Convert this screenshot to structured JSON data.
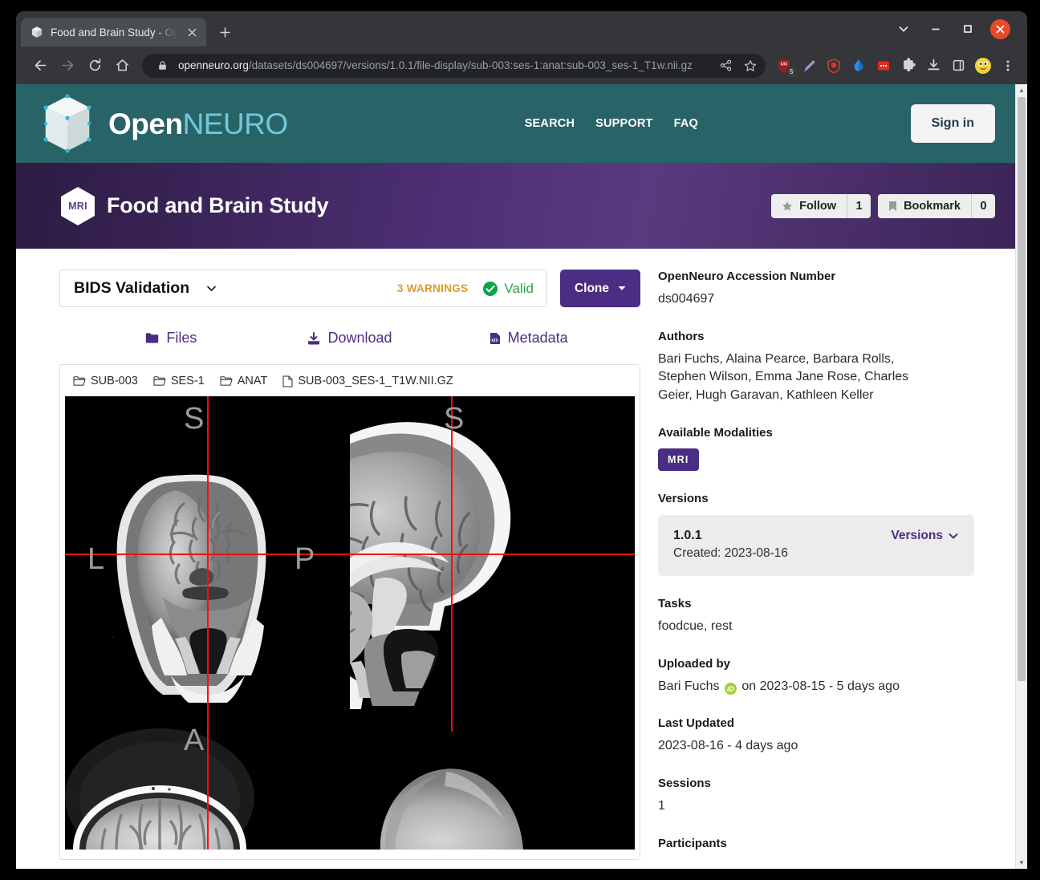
{
  "browser": {
    "tab": {
      "title": "Food and Brain Study - Op",
      "favicon_icon": "cube-icon",
      "close_icon": "close-icon"
    },
    "new_tab_icon": "plus-icon",
    "window_controls": [
      {
        "name": "chrome-menu-chevron",
        "icon": "chevron-down-icon"
      },
      {
        "name": "minimize-button",
        "icon": "minimize-icon"
      },
      {
        "name": "maximize-button",
        "icon": "maximize-icon"
      },
      {
        "name": "close-window-button",
        "icon": "close-icon"
      }
    ],
    "toolbar": {
      "back_icon": "back-arrow-icon",
      "forward_icon": "forward-arrow-icon",
      "reload_icon": "reload-icon",
      "home_icon": "home-icon",
      "lock_icon": "lock-icon",
      "url_domain": "openneuro.org",
      "url_path": "/datasets/ds004697/versions/1.0.1/file-display/sub-003:ses-1:anat:sub-003_ses-1_T1w.nii.gz",
      "share_icon": "share-icon",
      "bookmark_star_icon": "star-outline-icon",
      "extensions": [
        {
          "name": "ublock-origin-extension",
          "badge": "5"
        },
        {
          "name": "highlighter-extension",
          "badge": ""
        },
        {
          "name": "privacy-badger-extension",
          "badge": ""
        },
        {
          "name": "water-drop-extension",
          "badge": ""
        },
        {
          "name": "red-square-extension",
          "badge": ""
        },
        {
          "name": "extensions-puzzle-icon",
          "badge": ""
        },
        {
          "name": "downloads-icon",
          "badge": ""
        },
        {
          "name": "sidepanel-icon",
          "badge": ""
        }
      ],
      "profile_avatar": "profile-avatar",
      "menu_icon": "kebab-menu-icon"
    }
  },
  "site_header": {
    "logo_primary": "Open",
    "logo_secondary": "NEURO",
    "nav": [
      {
        "label": "SEARCH"
      },
      {
        "label": "SUPPORT"
      },
      {
        "label": "FAQ"
      }
    ],
    "sign_in": "Sign in"
  },
  "dataset_banner": {
    "modality_badge": "MRI",
    "title": "Food and Brain Study",
    "follow": {
      "label": "Follow",
      "count": "1",
      "icon": "star-icon"
    },
    "bookmark": {
      "label": "Bookmark",
      "count": "0",
      "icon": "bookmark-icon"
    }
  },
  "validation": {
    "title": "BIDS Validation",
    "chevron_icon": "chevron-down-icon",
    "warnings": "3 WARNINGS",
    "valid_label": "Valid",
    "valid_icon": "check-circle-icon",
    "clone_label": "Clone",
    "clone_caret_icon": "caret-down-icon"
  },
  "file_tabs": [
    {
      "label": "Files",
      "icon": "folder-icon"
    },
    {
      "label": "Download",
      "icon": "download-icon"
    },
    {
      "label": "Metadata",
      "icon": "metadata-file-icon"
    }
  ],
  "breadcrumbs": [
    {
      "label": "SUB-003",
      "icon": "folder-open-icon"
    },
    {
      "label": "SES-1",
      "icon": "folder-open-icon"
    },
    {
      "label": "ANAT",
      "icon": "folder-open-icon"
    },
    {
      "label": "SUB-003_SES-1_T1W.NII.GZ",
      "icon": "file-icon"
    }
  ],
  "nifti_viewer": {
    "orientation_labels": {
      "superior_coronal": "S",
      "left": "L",
      "superior_sagittal": "S",
      "posterior": "P",
      "anterior": "A"
    },
    "crosshair_color": "#fc0d0d"
  },
  "sidebar": {
    "accession": {
      "heading": "OpenNeuro Accession Number",
      "value": "ds004697"
    },
    "authors": {
      "heading": "Authors",
      "value": "Bari Fuchs, Alaina Pearce, Barbara Rolls, Stephen Wilson, Emma Jane Rose, Charles Geier, Hugh Garavan, Kathleen Keller"
    },
    "modalities": {
      "heading": "Available Modalities",
      "items": [
        "MRI"
      ]
    },
    "versions": {
      "heading": "Versions",
      "number": "1.0.1",
      "created": "Created: 2023-08-16",
      "link_label": "Versions",
      "link_icon": "chevron-down-icon"
    },
    "tasks": {
      "heading": "Tasks",
      "value": "foodcue, rest"
    },
    "uploaded_by": {
      "heading": "Uploaded by",
      "name": "Bari Fuchs",
      "orcid_icon": "orcid-id-icon",
      "orcid_label": "iD",
      "suffix": "on 2023-08-15 - 5 days ago"
    },
    "last_updated": {
      "heading": "Last Updated",
      "value": "2023-08-16 - 4 days ago"
    },
    "sessions": {
      "heading": "Sessions",
      "value": "1"
    },
    "participants": {
      "heading": "Participants"
    }
  },
  "colors": {
    "teal_header": "#286368",
    "purple_banner": "#4c2f73",
    "brand_purple": "#4b2e83",
    "logo_cyan": "#72c8d8",
    "warning_orange": "#e0992f",
    "valid_green": "#2aa64a",
    "orcid_green": "#a6ce39"
  }
}
